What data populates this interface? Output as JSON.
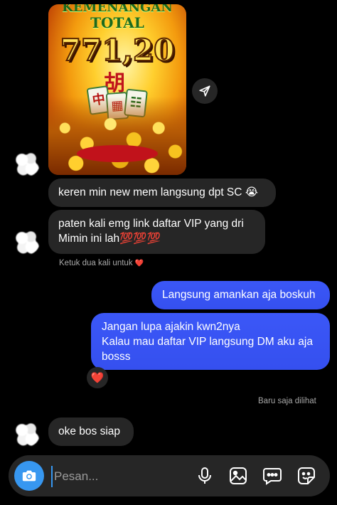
{
  "shared_image": {
    "text_top": "KEMENANGAN",
    "text_total": "TOTAL",
    "amount": "771,20",
    "char_main": "胡",
    "tile_a": "中"
  },
  "messages": [
    {
      "type": "incoming",
      "text": "keren min new mem langsung dpt SC 😭"
    },
    {
      "type": "incoming",
      "text": "paten kali emg link daftar VIP yang dri Mimin ini lah💯💯💯"
    },
    {
      "type": "outgoing",
      "text": "Langsung amankan aja boskuh"
    },
    {
      "type": "outgoing",
      "text": "Jangan lupa ajakin kwn2nya\nKalau mau daftar VIP langsung DM aku aja bosss"
    },
    {
      "type": "incoming",
      "text": "oke bos siap"
    }
  ],
  "hint_text": "Ketuk dua kali untuk",
  "hint_heart": "❤️",
  "reaction": "❤️",
  "seen_text": "Baru saja dilihat",
  "composer": {
    "placeholder": "Pesan..."
  },
  "icons": [
    "share-icon",
    "camera-icon",
    "microphone-icon",
    "gallery-icon",
    "chat-icon",
    "sticker-icon"
  ],
  "colors": {
    "outgoing_bubble": "#3550ef",
    "incoming_bubble": "#262626",
    "camera_button": "#3797f0",
    "background": "#000000"
  }
}
